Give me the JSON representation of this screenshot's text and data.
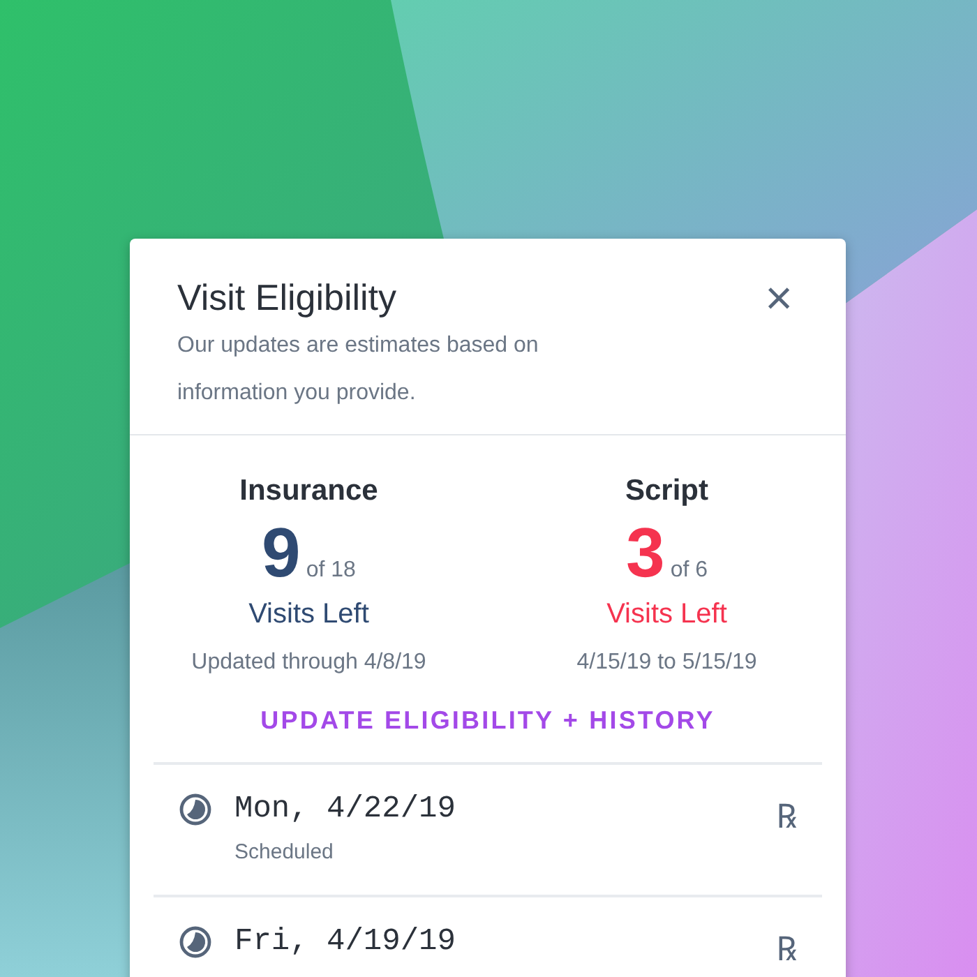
{
  "dialog": {
    "title": "Visit Eligibility",
    "subtitle": "Our updates are estimates based on information you provide.",
    "close": "×"
  },
  "stats": [
    {
      "label": "Insurance",
      "count": "9",
      "total": "of 18",
      "caption": "Visits Left",
      "note": "Updated through 4/8/19",
      "color": "#2f4a72"
    },
    {
      "label": "Script",
      "count": "3",
      "total": "of 6",
      "caption": "Visits Left",
      "note": "4/15/19 to 5/15/19",
      "color": "#f5334f"
    }
  ],
  "link": "UPDATE ELIGIBILITY + HISTORY",
  "visits": [
    {
      "date": "Mon, 4/22/19",
      "status": "Scheduled",
      "mark": "℞"
    },
    {
      "date": "Fri, 4/19/19",
      "mark": "℞"
    }
  ]
}
